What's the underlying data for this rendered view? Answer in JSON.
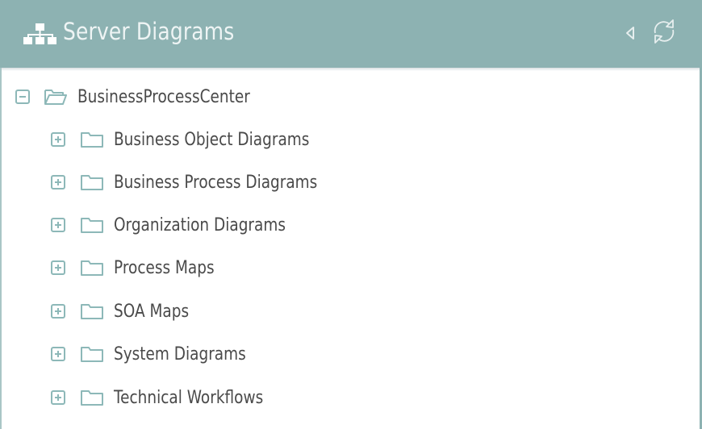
{
  "header": {
    "title": "Server Diagrams",
    "icon": "sitemap-icon",
    "actions": [
      {
        "name": "collapse-panel",
        "icon": "caret-left-icon"
      },
      {
        "name": "refresh",
        "icon": "refresh-icon"
      }
    ]
  },
  "colors": {
    "header_bg": "#8db2b2",
    "header_text": "#eef4f4",
    "icon_teal": "#8db8b8",
    "label_text": "#4a4a4a"
  },
  "tree": {
    "root": {
      "label": "BusinessProcessCenter",
      "expanded": true,
      "icon": "folder-open-icon"
    },
    "children": [
      {
        "label": "Business Object Diagrams",
        "expanded": false,
        "icon": "folder-icon"
      },
      {
        "label": "Business Process Diagrams",
        "expanded": false,
        "icon": "folder-icon"
      },
      {
        "label": "Organization Diagrams",
        "expanded": false,
        "icon": "folder-icon"
      },
      {
        "label": "Process Maps",
        "expanded": false,
        "icon": "folder-icon"
      },
      {
        "label": "SOA Maps",
        "expanded": false,
        "icon": "folder-icon"
      },
      {
        "label": "System Diagrams",
        "expanded": false,
        "icon": "folder-icon"
      },
      {
        "label": "Technical Workflows",
        "expanded": false,
        "icon": "folder-icon"
      }
    ]
  }
}
